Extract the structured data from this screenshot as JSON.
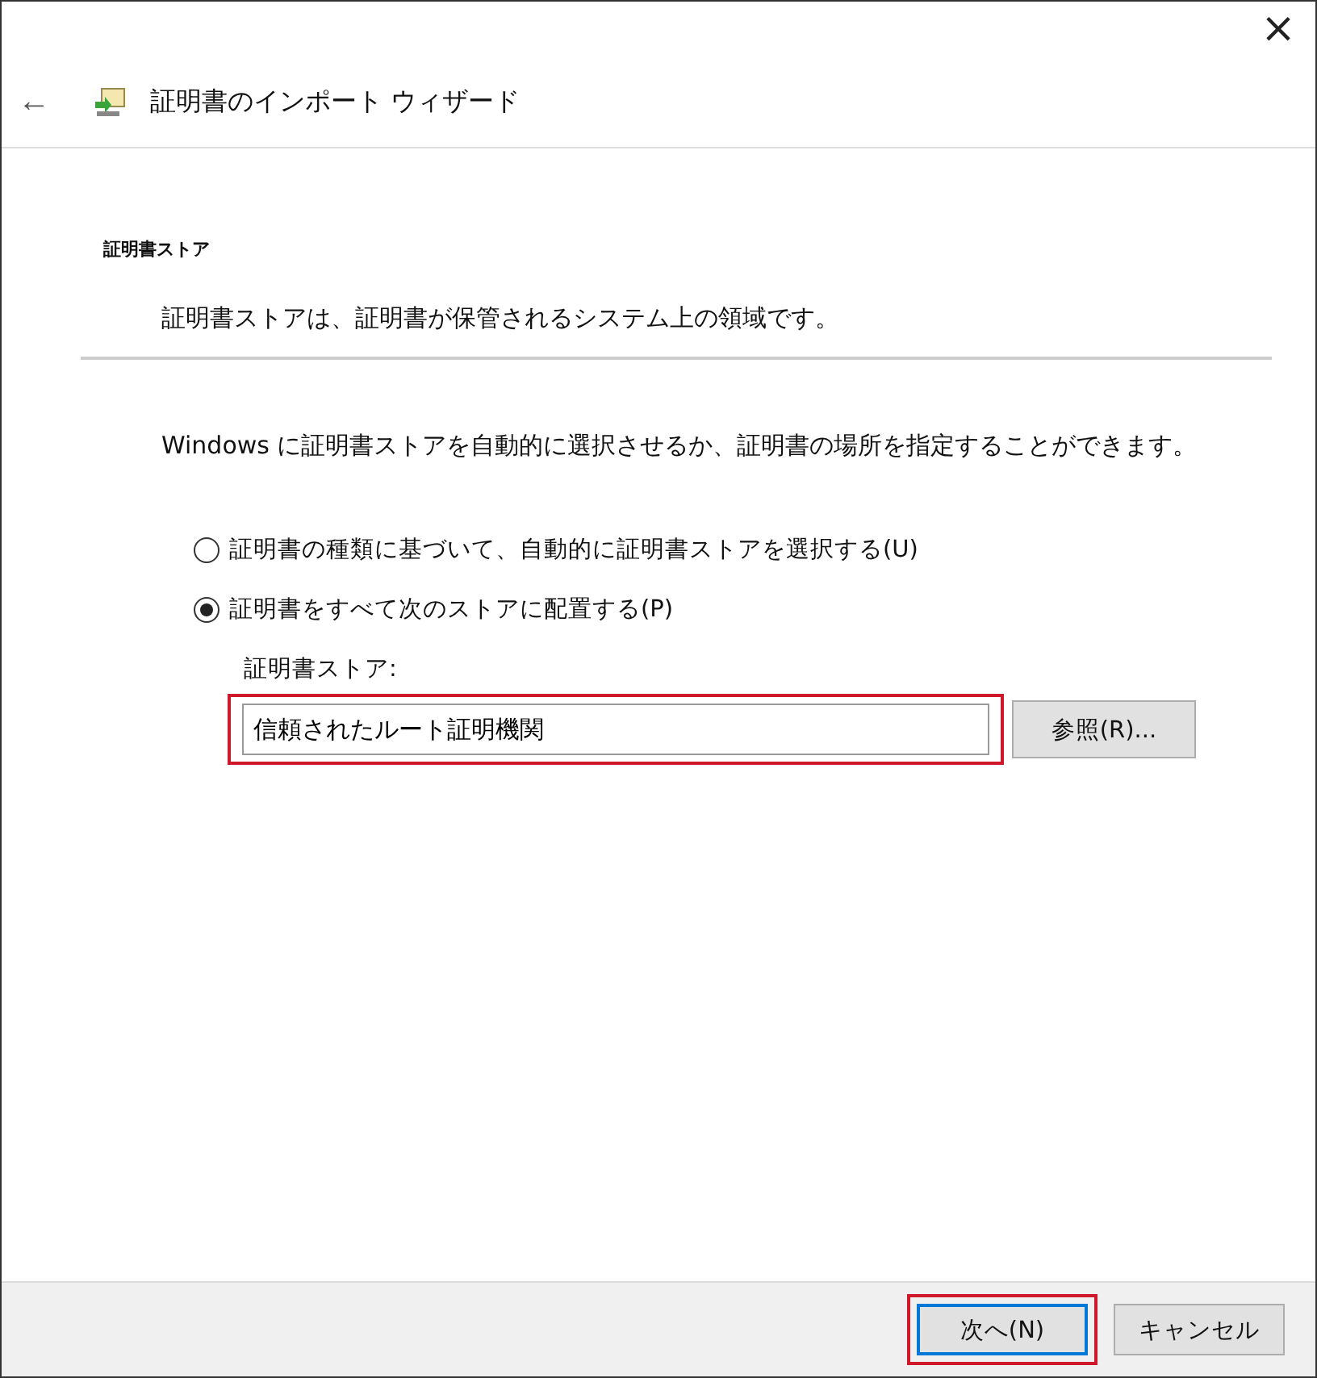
{
  "window": {
    "title": "証明書のインポート ウィザード",
    "close": "×",
    "back": "←"
  },
  "section": {
    "heading": "証明書ストア",
    "subtitle": "証明書ストアは、証明書が保管されるシステム上の領域です。"
  },
  "description": "Windows に証明書ストアを自動的に選択させるか、証明書の場所を指定することができます。",
  "options": [
    {
      "label": "証明書の種類に基づいて、自動的に証明書ストアを選択する(U)",
      "selected": false
    },
    {
      "label": "証明書をすべて次のストアに配置する(P)",
      "selected": true
    }
  ],
  "store_field": {
    "label": "証明書ストア:",
    "value": "信頼されたルート証明機関",
    "highlighted": true
  },
  "browse_button": "参照(R)...",
  "buttons": [
    {
      "label": "次へ(N)",
      "default": true,
      "highlighted": true
    },
    {
      "label": "キャンセル",
      "default": false,
      "highlighted": false
    }
  ]
}
